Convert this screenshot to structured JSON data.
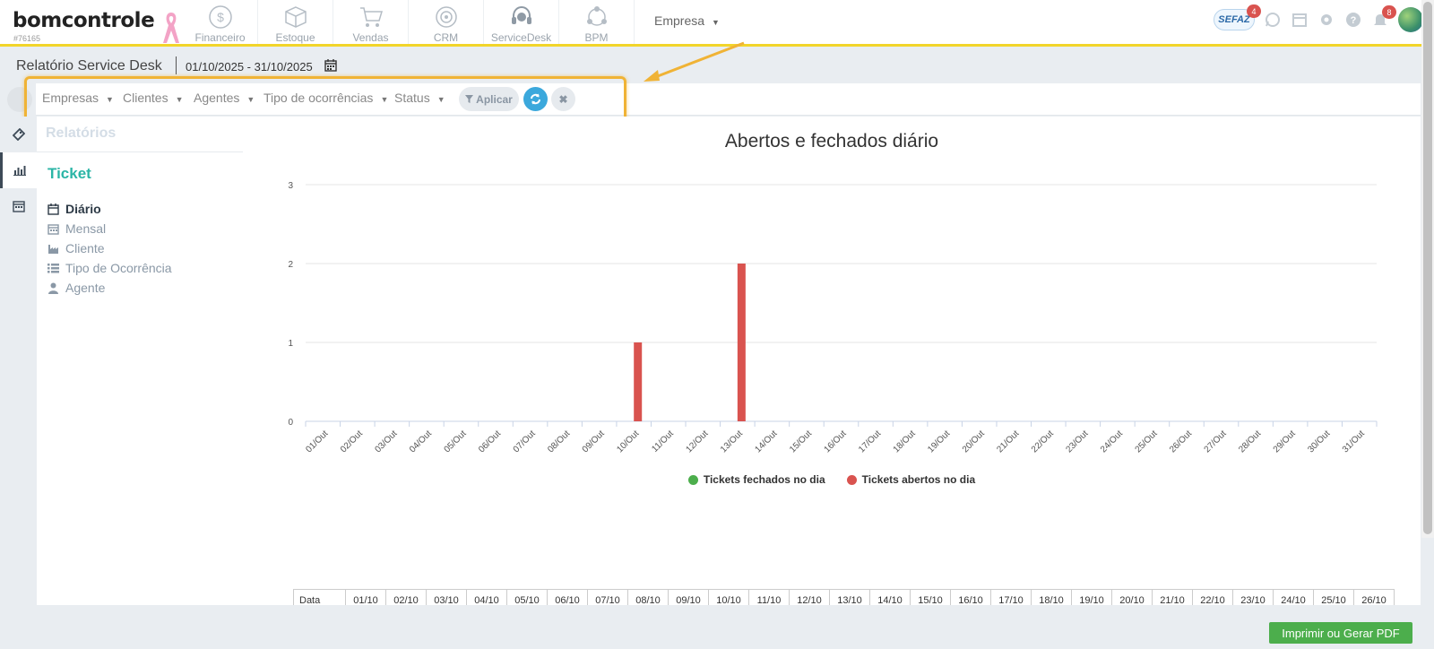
{
  "logo": {
    "text": "bomcontrole",
    "id": "#76165"
  },
  "nav": [
    {
      "label": "Financeiro",
      "icon": "dollar-icon"
    },
    {
      "label": "Estoque",
      "icon": "box-icon"
    },
    {
      "label": "Vendas",
      "icon": "cart-icon"
    },
    {
      "label": "CRM",
      "icon": "target-icon"
    },
    {
      "label": "ServiceDesk",
      "icon": "headset-icon"
    },
    {
      "label": "BPM",
      "icon": "network-icon"
    }
  ],
  "empresa_menu": "Empresa",
  "topright": {
    "sefaz_label": "SEFAZ",
    "sefaz_badge": "4",
    "notif_badge": "8"
  },
  "header": {
    "title": "Relatório Service Desk",
    "date_range": "01/10/2025 - 31/10/2025"
  },
  "filters": {
    "items": [
      "Empresas",
      "Clientes",
      "Agentes",
      "Tipo de ocorrências",
      "Status"
    ],
    "apply_label": "Aplicar"
  },
  "sidebar": {
    "section_title": "Relatórios",
    "group_title": "Ticket",
    "items": [
      {
        "label": "Diário",
        "icon": "calendar-icon",
        "active": true
      },
      {
        "label": "Mensal",
        "icon": "calendar-grid-icon",
        "active": false
      },
      {
        "label": "Cliente",
        "icon": "factory-icon",
        "active": false
      },
      {
        "label": "Tipo de Ocorrência",
        "icon": "list-icon",
        "active": false
      },
      {
        "label": "Agente",
        "icon": "user-icon",
        "active": false
      }
    ]
  },
  "chart_data": {
    "type": "bar",
    "title": "Abertos e fechados diário",
    "categories": [
      "01/Out",
      "02/Out",
      "03/Out",
      "04/Out",
      "05/Out",
      "06/Out",
      "07/Out",
      "08/Out",
      "09/Out",
      "10/Out",
      "11/Out",
      "12/Out",
      "13/Out",
      "14/Out",
      "15/Out",
      "16/Out",
      "17/Out",
      "18/Out",
      "19/Out",
      "20/Out",
      "21/Out",
      "22/Out",
      "23/Out",
      "24/Out",
      "25/Out",
      "26/Out",
      "27/Out",
      "28/Out",
      "29/Out",
      "30/Out",
      "31/Out"
    ],
    "series": [
      {
        "name": "Tickets fechados no dia",
        "color": "#4cae4c",
        "values": [
          0,
          0,
          0,
          0,
          0,
          0,
          0,
          0,
          0,
          0,
          0,
          0,
          0,
          0,
          0,
          0,
          0,
          0,
          0,
          0,
          0,
          0,
          0,
          0,
          0,
          0,
          0,
          0,
          0,
          0,
          0
        ]
      },
      {
        "name": "Tickets abertos no dia",
        "color": "#d9534f",
        "values": [
          0,
          0,
          0,
          0,
          0,
          0,
          0,
          0,
          0,
          1,
          0,
          0,
          2,
          0,
          0,
          0,
          0,
          0,
          0,
          0,
          0,
          0,
          0,
          0,
          0,
          0,
          0,
          0,
          0,
          0,
          0
        ]
      }
    ],
    "ylim": [
      0,
      3
    ],
    "yticks": [
      0,
      1,
      2,
      3
    ],
    "grid": true,
    "legend": "bottom"
  },
  "table": {
    "header": "Data",
    "dates": [
      "01/10",
      "02/10",
      "03/10",
      "04/10",
      "05/10",
      "06/10",
      "07/10",
      "08/10",
      "09/10",
      "10/10",
      "11/10",
      "12/10",
      "13/10",
      "14/10",
      "15/10",
      "16/10",
      "17/10",
      "18/10",
      "19/10",
      "20/10",
      "21/10",
      "22/10",
      "23/10",
      "24/10",
      "25/10",
      "26/10"
    ]
  },
  "pdf_button": "Imprimir ou Gerar PDF"
}
